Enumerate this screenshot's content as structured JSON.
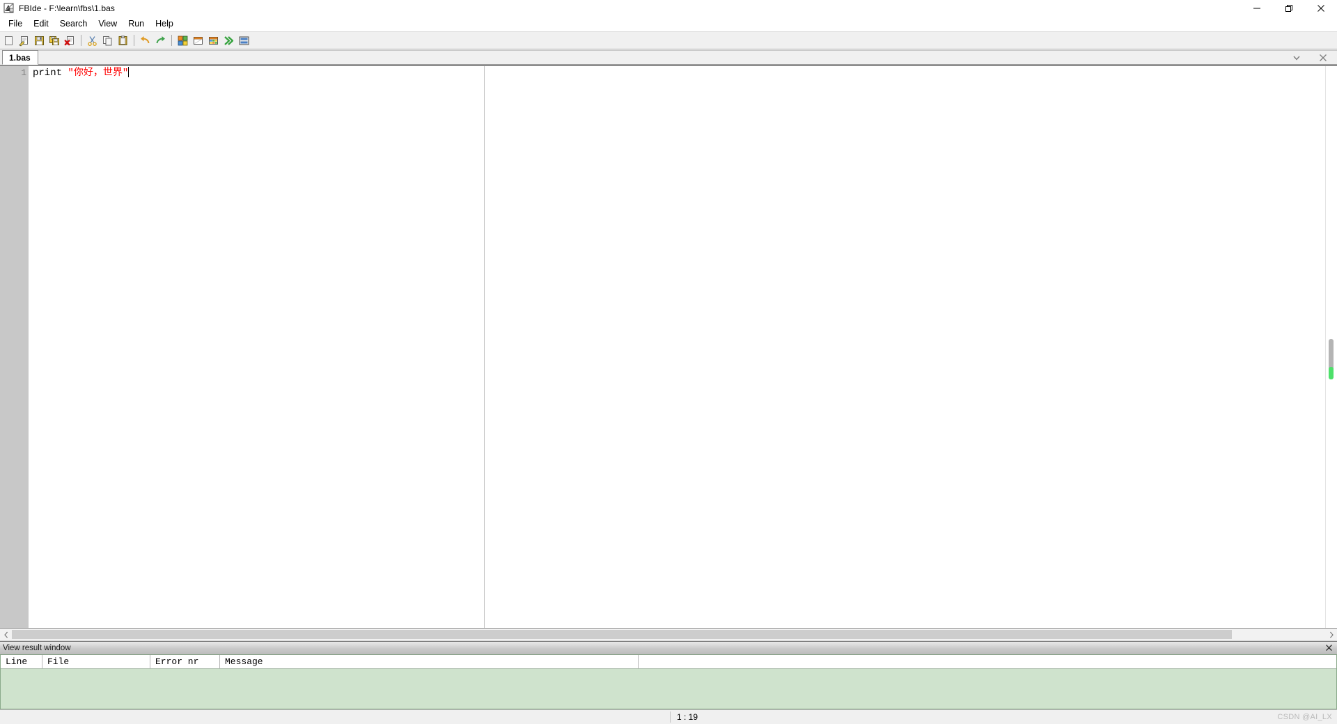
{
  "window": {
    "title": "FBIde - F:\\learn\\fbs\\1.bas",
    "app_icon": "fbide-icon",
    "controls": {
      "minimize": "minimize-icon",
      "maximize": "restore-icon",
      "close": "close-icon"
    }
  },
  "menubar": {
    "items": [
      {
        "label": "File",
        "name": "menu-file"
      },
      {
        "label": "Edit",
        "name": "menu-edit"
      },
      {
        "label": "Search",
        "name": "menu-search"
      },
      {
        "label": "View",
        "name": "menu-view"
      },
      {
        "label": "Run",
        "name": "menu-run"
      },
      {
        "label": "Help",
        "name": "menu-help"
      }
    ]
  },
  "toolbar": {
    "buttons": [
      {
        "icon": "new-file-icon",
        "tooltip": "New"
      },
      {
        "icon": "open-file-icon",
        "tooltip": "Open"
      },
      {
        "icon": "save-icon",
        "tooltip": "Save"
      },
      {
        "icon": "save-all-icon",
        "tooltip": "Save All"
      },
      {
        "icon": "close-file-icon",
        "tooltip": "Close"
      },
      {
        "icon": "cut-icon",
        "tooltip": "Cut"
      },
      {
        "icon": "copy-icon",
        "tooltip": "Copy"
      },
      {
        "icon": "paste-icon",
        "tooltip": "Paste"
      },
      {
        "icon": "undo-icon",
        "tooltip": "Undo"
      },
      {
        "icon": "redo-icon",
        "tooltip": "Redo"
      },
      {
        "icon": "panels-icon",
        "tooltip": "Panels"
      },
      {
        "icon": "output-window-icon",
        "tooltip": "Output Window"
      },
      {
        "icon": "result-window-icon",
        "tooltip": "Result Window"
      },
      {
        "icon": "run-icon",
        "tooltip": "Run"
      },
      {
        "icon": "console-icon",
        "tooltip": "Console"
      }
    ]
  },
  "tabbar": {
    "tabs": [
      {
        "label": "1.bas",
        "active": true
      }
    ],
    "dropdown_icon": "chevron-down-icon",
    "close_icon": "close-icon"
  },
  "editor": {
    "line_number": "1",
    "code": {
      "keyword": "print ",
      "string": "\"你好，世界\""
    },
    "full_line": "print \"你好，世界\""
  },
  "result_window": {
    "title": "View result window",
    "close_icon": "close-icon",
    "columns": [
      "Line",
      "File",
      "Error nr",
      "Message",
      ""
    ],
    "rows": []
  },
  "statusbar": {
    "cursor_position": "1 : 19",
    "watermark": "CSDN @AI_LX"
  },
  "colors": {
    "string_red": "#ff0000",
    "result_green": "#cfe3cd",
    "gutter_gray": "#c8c8c8",
    "scroll_green": "#4de06a"
  }
}
